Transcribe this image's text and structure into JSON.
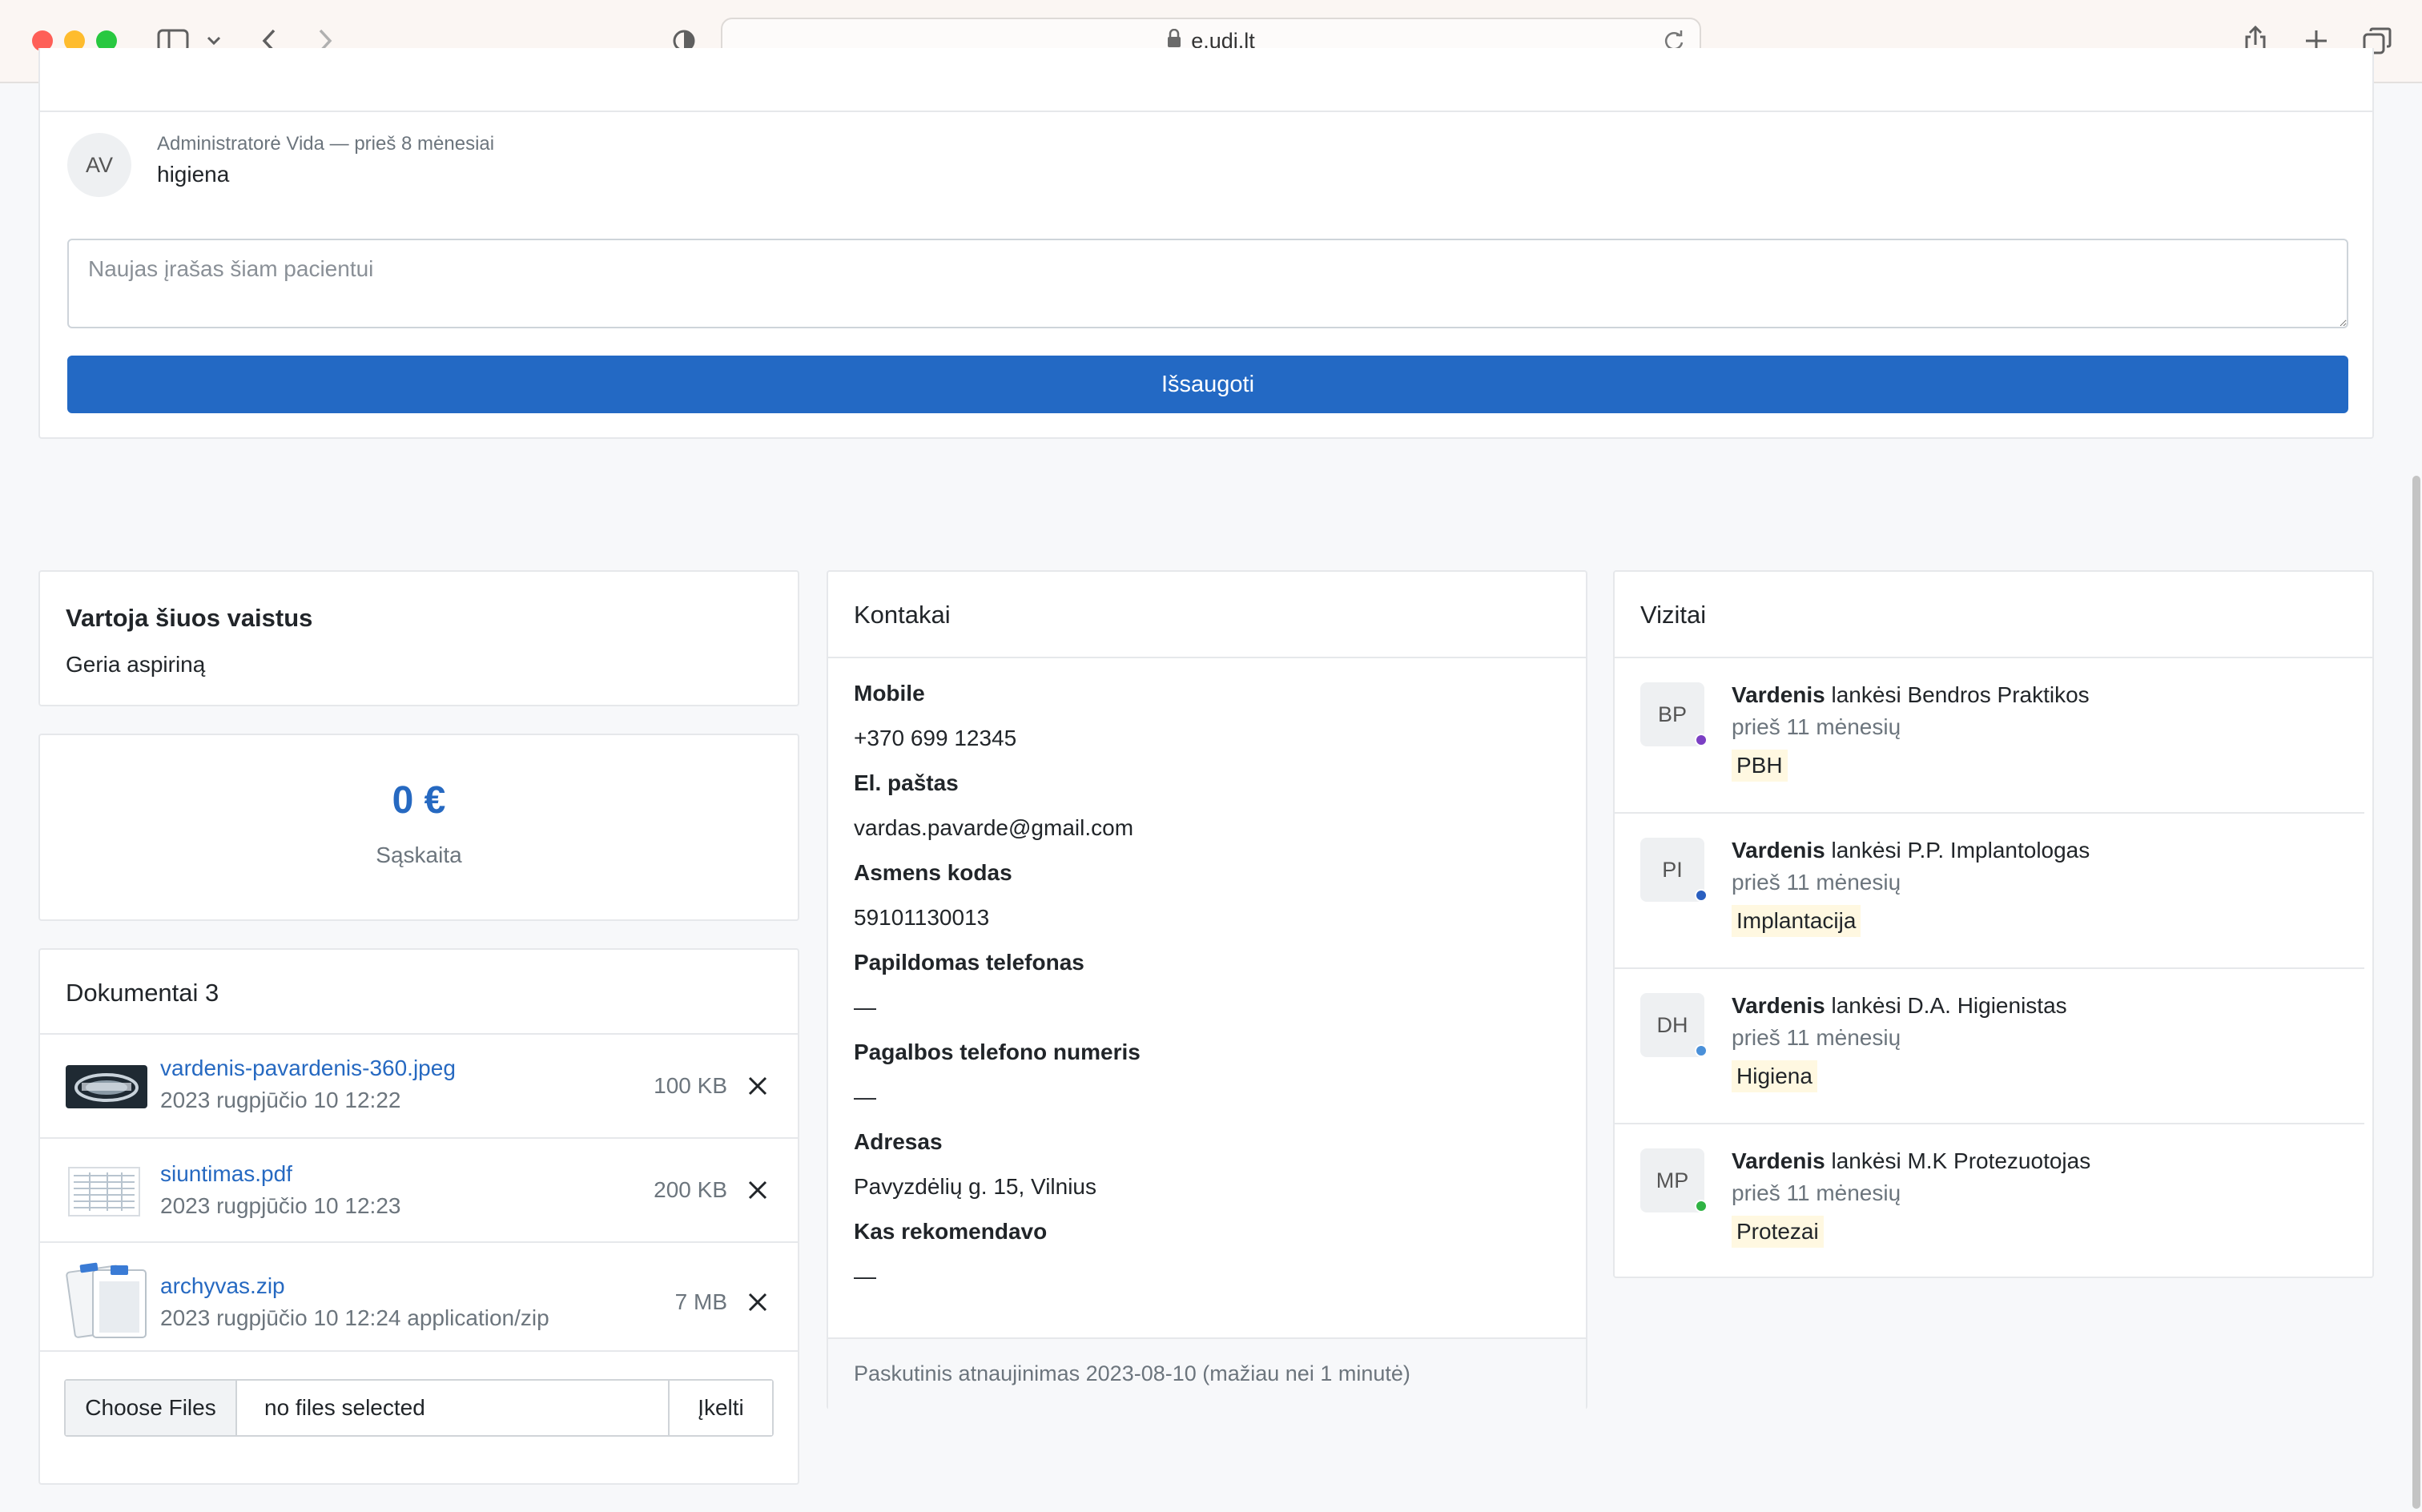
{
  "browser": {
    "url": "e.udi.lt"
  },
  "notes": {
    "avatar": "AV",
    "meta": "Administratorė Vida — prieš 8 mėnesiai",
    "text": "higiena",
    "input_placeholder": "Naujas įrašas šiam pacientui",
    "input_value": "",
    "save_label": "Išsaugoti"
  },
  "medications": {
    "title": "Vartoja šiuos vaistus",
    "text": "Geria aspiriną"
  },
  "balance": {
    "amount": "0 €",
    "label": "Sąskaita"
  },
  "documents": {
    "title": "Dokumentai 3",
    "items": [
      {
        "name": "vardenis-pavardenis-360.jpeg",
        "date": "2023 rugpjūčio 10 12:22",
        "size": "100 KB",
        "thumb": "xray-thumbnail"
      },
      {
        "name": "siuntimas.pdf",
        "date": "2023 rugpjūčio 10 12:23",
        "size": "200 KB",
        "thumb": "document-thumbnail"
      },
      {
        "name": "archyvas.zip",
        "date": "2023 rugpjūčio 10 12:24 application/zip",
        "size": "7 MB",
        "thumb": "archive-icon"
      }
    ],
    "choose_label": "Choose Files",
    "file_status": "no files selected",
    "upload_label": "Įkelti"
  },
  "contacts": {
    "title": "Kontakai",
    "fields": [
      {
        "label": "Mobile",
        "value": "+370 699 12345",
        "is_link": true
      },
      {
        "label": "El. paštas",
        "value": "vardas.pavarde@gmail.com"
      },
      {
        "label": "Asmens kodas",
        "value": "59101130013"
      },
      {
        "label": "Papildomas telefonas",
        "value": "—"
      },
      {
        "label": "Pagalbos telefono numeris",
        "value": "—"
      },
      {
        "label": "Adresas",
        "value": "Pavyzdėlių g. 15, Vilnius"
      },
      {
        "label": "Kas rekomendavo",
        "value": "—"
      }
    ],
    "footer": "Paskutinis atnaujinimas 2023-08-10 (mažiau nei 1 minutė)"
  },
  "visits": {
    "title": "Vizitai",
    "items": [
      {
        "initials": "BP",
        "name": "Vardenis",
        "action": "lankėsi Bendros Praktikos",
        "time": "prieš 11 mėnesių",
        "tag": "PBH",
        "dot_color": "#7b3fc4"
      },
      {
        "initials": "PI",
        "name": "Vardenis",
        "action": "lankėsi P.P. Implantologas",
        "time": "prieš 11 mėnesių",
        "tag": "Implantacija",
        "dot_color": "#2a5fc0"
      },
      {
        "initials": "DH",
        "name": "Vardenis",
        "action": "lankėsi D.A. Higienistas",
        "time": "prieš 11 mėnesių",
        "tag": "Higiena",
        "dot_color": "#4a90d9"
      },
      {
        "initials": "MP",
        "name": "Vardenis",
        "action": "lankėsi M.K Protezuotojas",
        "time": "prieš 11 mėnesių",
        "tag": "Protezai",
        "dot_color": "#2fb344"
      }
    ]
  }
}
